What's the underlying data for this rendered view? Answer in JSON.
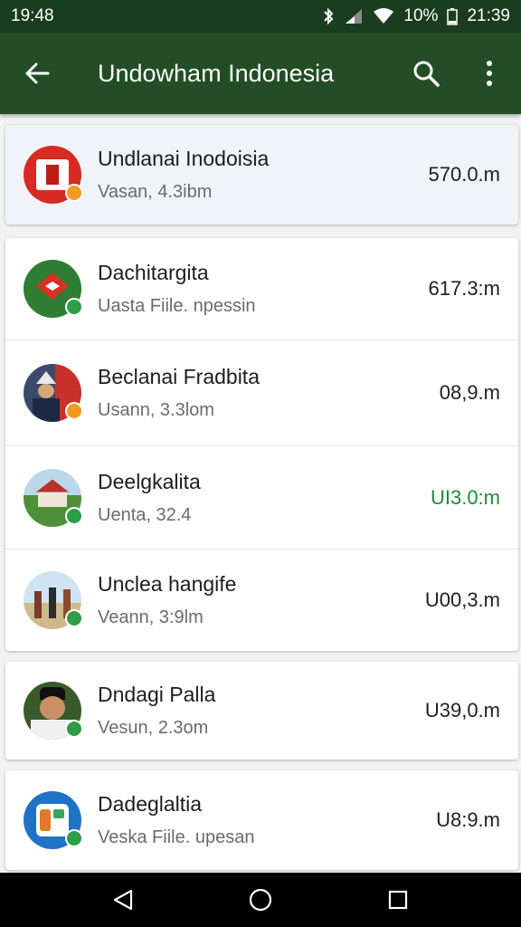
{
  "status_bar": {
    "left_time": "19:48",
    "battery": "10%",
    "clock": "21:39"
  },
  "app_bar": {
    "title": "Undowham Indonesia",
    "back_icon": "arrow-left-icon",
    "search_icon": "search-icon",
    "menu_icon": "more-vert-icon"
  },
  "items": [
    {
      "name": "Undlanai Inodoisia",
      "sub": "Vasan, 4.3ibm",
      "size": "570.0.m",
      "badge": "orange",
      "avatar": "flag-red"
    },
    {
      "name": "Dachitargita",
      "sub": "Uasta Fiile. npessin",
      "size": "617.3:m",
      "badge": "green",
      "avatar": "emblem-green"
    },
    {
      "name": "Beclanai Fradbita",
      "sub": "Usann, 3.3lom",
      "size": "08,9.m",
      "badge": "orange",
      "avatar": "person-hat"
    },
    {
      "name": "Deelgkalita",
      "sub": "Uenta, 32.4",
      "size": "UI3.0:m",
      "badge": "green",
      "avatar": "house-landscape",
      "green_size": true
    },
    {
      "name": "Unclea hangife",
      "sub": "Veann, 3:9lm",
      "size": "U00,3.m",
      "badge": "green",
      "avatar": "dancers"
    },
    {
      "name": "Dndagi Palla",
      "sub": "Vesun, 2.3om",
      "size": "U39,0.m",
      "badge": "green",
      "avatar": "person-portrait"
    },
    {
      "name": "Dadeglaltia",
      "sub": "Veska Fiile. upesan",
      "size": "U8:9.m",
      "badge": "green",
      "avatar": "app-icon-blue"
    }
  ],
  "colors": {
    "status_bar": "#1b3d1f",
    "app_bar": "#224d25",
    "badge_green": "#2e9e48",
    "badge_orange": "#f39a1f",
    "size_green": "#1f8a3a"
  },
  "nav": {
    "back": "nav-back-icon",
    "home": "nav-home-icon",
    "recents": "nav-recents-icon"
  }
}
